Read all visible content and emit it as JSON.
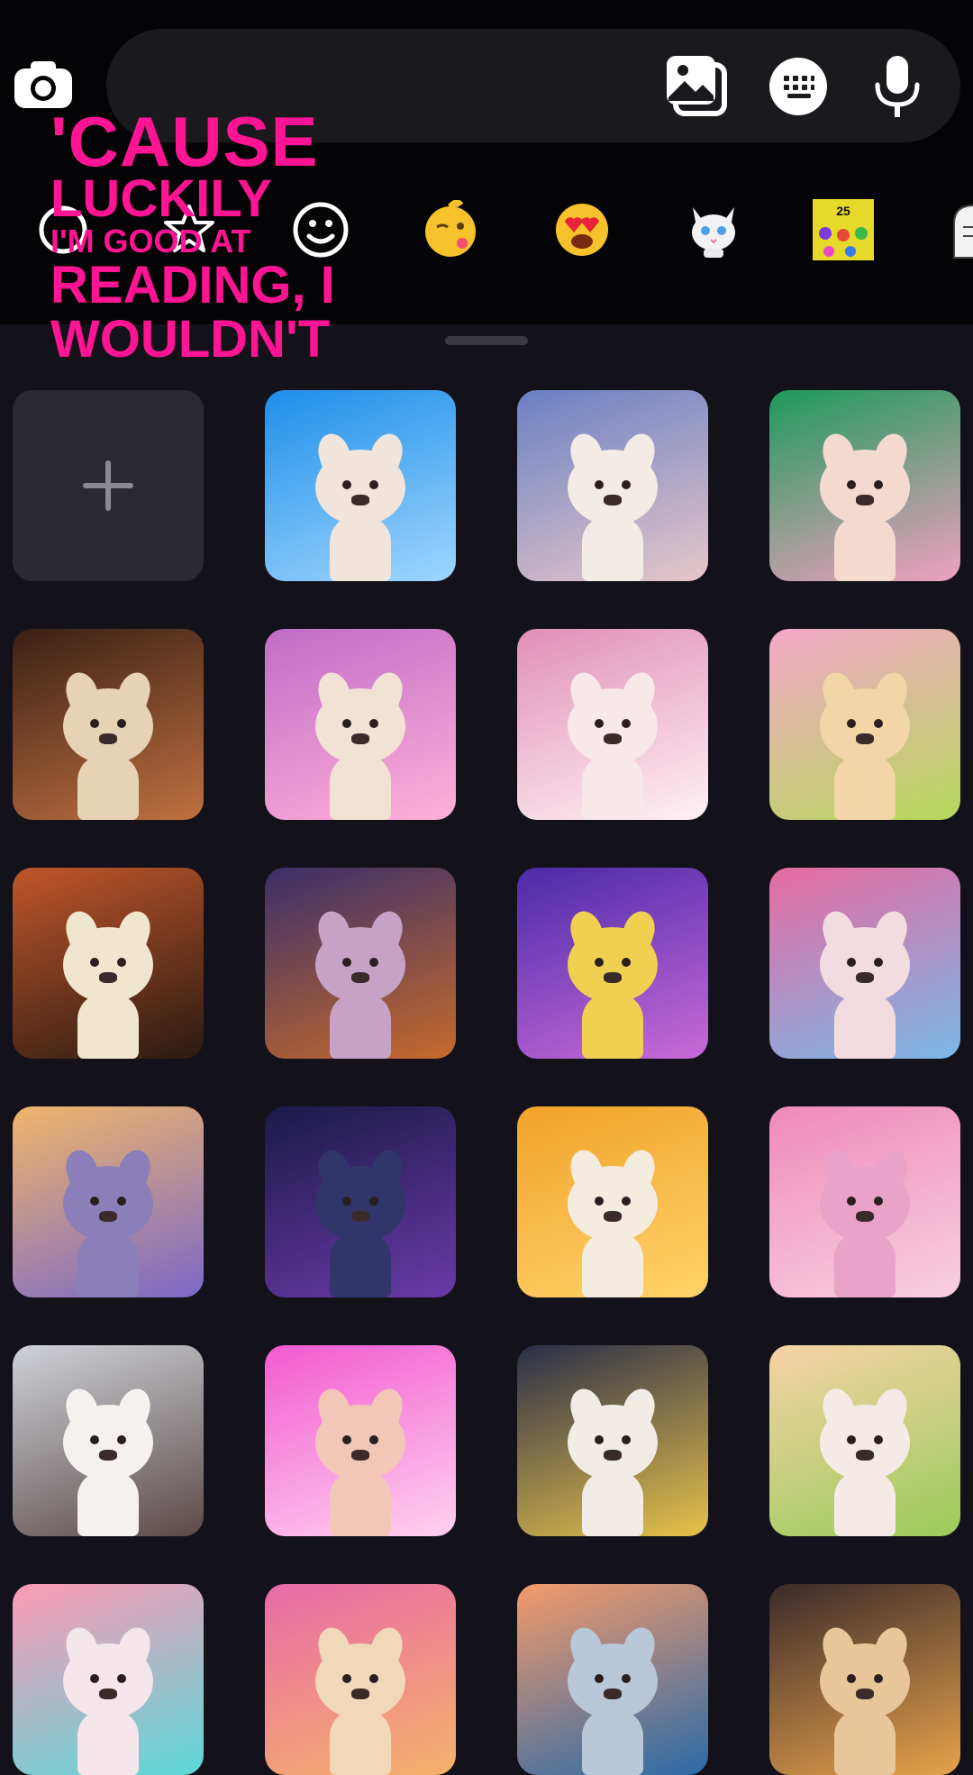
{
  "caption": {
    "lines": [
      "'CAUSE",
      "LUCKILY",
      "I'M GOOD AT",
      "READING, I",
      "WOULDN'T"
    ]
  },
  "icons": {
    "camera": "camera-icon",
    "photo_library": "photo-library-icon",
    "keyboard": "keyboard-icon",
    "microphone": "microphone-icon",
    "add": "plus-icon"
  },
  "tabs": [
    {
      "name": "recent-icon",
      "glyph": "◯"
    },
    {
      "name": "star-icon",
      "glyph": "☆"
    },
    {
      "name": "smiley-icon",
      "glyph": "☺"
    },
    {
      "name": "kissing-emoji-icon",
      "glyph": "😘"
    },
    {
      "name": "heart-eyes-emoji-icon",
      "glyph": "😍"
    },
    {
      "name": "cat-sticker-icon",
      "glyph": "🐱"
    },
    {
      "name": "sticker-pack-icon",
      "glyph": "25"
    },
    {
      "name": "character-sticker-icon",
      "glyph": "☃"
    }
  ],
  "stickers": [
    {
      "id": "add"
    },
    {
      "name": "surfing-bulldog",
      "bg": [
        "#1e8ee8",
        "#9ed6ff"
      ],
      "dog": "#f1e4da"
    },
    {
      "name": "penguin-bulldogs",
      "bg": [
        "#6a7fc4",
        "#e6c7c8"
      ],
      "dog": "#f3ece6"
    },
    {
      "name": "aurora-bulldog",
      "bg": [
        "#1c9a5a",
        "#f0a0c0"
      ],
      "dog": "#f4d9cf"
    },
    {
      "name": "chef-bulldog",
      "bg": [
        "#3a2015",
        "#c07040"
      ],
      "dog": "#e6d2b5"
    },
    {
      "name": "rainbow-wave-bulldog",
      "bg": [
        "#c06cc8",
        "#ffb0d8"
      ],
      "dog": "#f1e2d3"
    },
    {
      "name": "smiling-bulldog-closeup",
      "bg": [
        "#e08fb5",
        "#fff1f4"
      ],
      "dog": "#f8e8ea"
    },
    {
      "name": "candy-land-bulldog",
      "bg": [
        "#f3a7c9",
        "#b5d85a"
      ],
      "dog": "#f3d6a8"
    },
    {
      "name": "drummer-bulldog",
      "bg": [
        "#c0562a",
        "#2a1a12"
      ],
      "dog": "#f0e6cf"
    },
    {
      "name": "sunflower-bulldog",
      "bg": [
        "#3a2f6a",
        "#c66a2a"
      ],
      "dog": "#c6a2c6"
    },
    {
      "name": "party-crowd-bulldog",
      "bg": [
        "#4a2aa8",
        "#c96ad8"
      ],
      "dog": "#f0d050"
    },
    {
      "name": "bouquet-bulldog",
      "bg": [
        "#e76aa0",
        "#7ab8e8"
      ],
      "dog": "#f3dce0"
    },
    {
      "name": "sunset-bulldog",
      "bg": [
        "#f1b56a",
        "#7a68c8"
      ],
      "dog": "#8a7fb8"
    },
    {
      "name": "suited-bulldog",
      "bg": [
        "#1a1a48",
        "#6a3aa8"
      ],
      "dog": "#30356a"
    },
    {
      "name": "golden-sparkle-bulldog",
      "bg": [
        "#f1a22a",
        "#ffd36a"
      ],
      "dog": "#f5ece0"
    },
    {
      "name": "bubble-bulldog",
      "bg": [
        "#f08ab8",
        "#f8d0e0"
      ],
      "dog": "#e9a2c8"
    },
    {
      "name": "shopping-bulldog",
      "bg": [
        "#cfd2d8",
        "#5a4a48"
      ],
      "dog": "#f5f1ee"
    },
    {
      "name": "pink-disco-bulldog",
      "bg": [
        "#f25ad0",
        "#ffd2f0"
      ],
      "dog": "#f3c7b8"
    },
    {
      "name": "banana-friends-bulldog",
      "bg": [
        "#2a2e48",
        "#e7c24a"
      ],
      "dog": "#f1ece6"
    },
    {
      "name": "bunny-ears-bulldog",
      "bg": [
        "#f6d3a6",
        "#9acb5a"
      ],
      "dog": "#f5ebe6"
    },
    {
      "name": "candy-shore-bulldog",
      "bg": [
        "#ff9ab5",
        "#5ad8d8"
      ],
      "dog": "#f4e6ea"
    },
    {
      "name": "carnival-bulldog",
      "bg": [
        "#e86aa8",
        "#f6b26a"
      ],
      "dog": "#f0d8b8"
    },
    {
      "name": "ocean-sunset-bulldogs",
      "bg": [
        "#f59a6a",
        "#2a6aa8"
      ],
      "dog": "#b8c8d8"
    },
    {
      "name": "chef-hat-bulldog",
      "bg": [
        "#3a2a2a",
        "#e7a24a"
      ],
      "dog": "#e8c69a"
    }
  ]
}
